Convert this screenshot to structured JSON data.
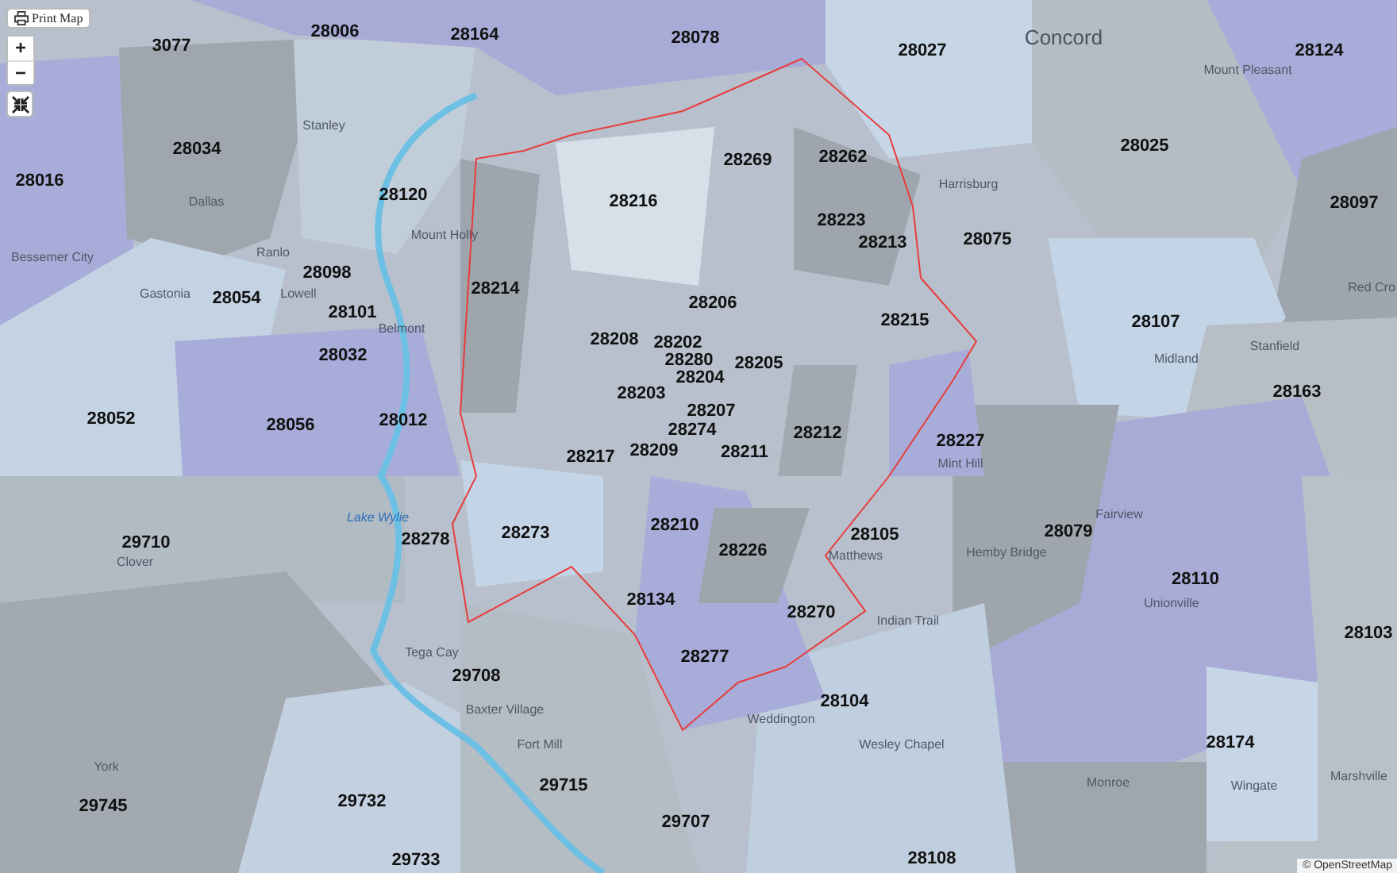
{
  "controls": {
    "print_button": "Print Map",
    "zoom_in": "+",
    "zoom_out": "−"
  },
  "zip_codes": [
    "3077",
    "28006",
    "28164",
    "28078",
    "28027",
    "28124",
    "28034",
    "28016",
    "28120",
    "28025",
    "28097",
    "28269",
    "28262",
    "28216",
    "28223",
    "28213",
    "28075",
    "28098",
    "28054",
    "28101",
    "28214",
    "28206",
    "28215",
    "28107",
    "28032",
    "28208",
    "28202",
    "28280",
    "28204",
    "28205",
    "28203",
    "28163",
    "28052",
    "28056",
    "28012",
    "28207",
    "28274",
    "28209",
    "28212",
    "28227",
    "28217",
    "28211",
    "28079",
    "29710",
    "28278",
    "28273",
    "28210",
    "28226",
    "28105",
    "28110",
    "28134",
    "28270",
    "28103",
    "29708",
    "28277",
    "28104",
    "28174",
    "29715",
    "29745",
    "29732",
    "29707",
    "29733",
    "28108"
  ],
  "places": [
    {
      "name": "Concord",
      "kind": "city"
    },
    {
      "name": "Mount Pleasant",
      "kind": "town"
    },
    {
      "name": "Stanley",
      "kind": "town"
    },
    {
      "name": "Dallas",
      "kind": "town"
    },
    {
      "name": "Mount Holly",
      "kind": "town"
    },
    {
      "name": "Bessemer City",
      "kind": "town"
    },
    {
      "name": "Ranlo",
      "kind": "town"
    },
    {
      "name": "Lowell",
      "kind": "town"
    },
    {
      "name": "Gastonia",
      "kind": "town"
    },
    {
      "name": "Belmont",
      "kind": "town"
    },
    {
      "name": "Harrisburg",
      "kind": "town"
    },
    {
      "name": "Midland",
      "kind": "town"
    },
    {
      "name": "Stanfield",
      "kind": "town"
    },
    {
      "name": "Red Cro",
      "kind": "town"
    },
    {
      "name": "Mint Hill",
      "kind": "town"
    },
    {
      "name": "Lake Wylie",
      "kind": "water"
    },
    {
      "name": "Clover",
      "kind": "town"
    },
    {
      "name": "York",
      "kind": "town"
    },
    {
      "name": "Matthews",
      "kind": "town"
    },
    {
      "name": "Fairview",
      "kind": "town"
    },
    {
      "name": "Hemby Bridge",
      "kind": "town"
    },
    {
      "name": "Unionville",
      "kind": "town"
    },
    {
      "name": "Indian Trail",
      "kind": "town"
    },
    {
      "name": "Tega Cay",
      "kind": "town"
    },
    {
      "name": "Baxter Village",
      "kind": "town"
    },
    {
      "name": "Fort Mill",
      "kind": "town"
    },
    {
      "name": "Weddington",
      "kind": "town"
    },
    {
      "name": "Wesley Chapel",
      "kind": "town"
    },
    {
      "name": "Monroe",
      "kind": "town"
    },
    {
      "name": "Wingate",
      "kind": "town"
    },
    {
      "name": "Marshville",
      "kind": "town"
    }
  ],
  "attribution": "© OpenStreetMap"
}
